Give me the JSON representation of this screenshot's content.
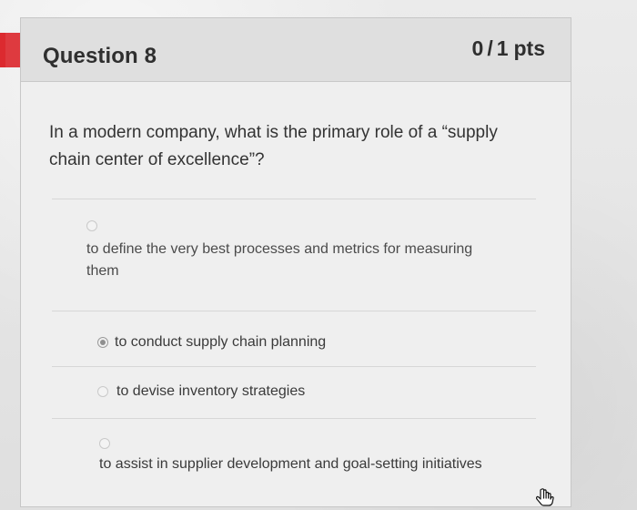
{
  "question": {
    "title": "Question 8",
    "score": "0",
    "slash": "/",
    "possible": "1",
    "unit": "pts",
    "prompt": "In a modern company, what is the primary role of a “supply chain center of excellence”?"
  },
  "answers": [
    {
      "label": "to define the very best processes and metrics for measuring them",
      "selected": false
    },
    {
      "label": "to conduct supply chain planning",
      "selected": true
    },
    {
      "label": "to devise inventory strategies",
      "selected": false
    },
    {
      "label": "to assist in supplier development and goal-setting initiatives",
      "selected": false
    }
  ],
  "colors": {
    "accent_red": "#dc2a2f",
    "card_bg": "#f1f1f1",
    "header_bg": "#dfdfdf",
    "text": "#2d2d2d"
  },
  "icons": {
    "bookmark": "bookmark-icon",
    "radio": "radio-icon",
    "cursor": "hand-cursor-icon"
  }
}
